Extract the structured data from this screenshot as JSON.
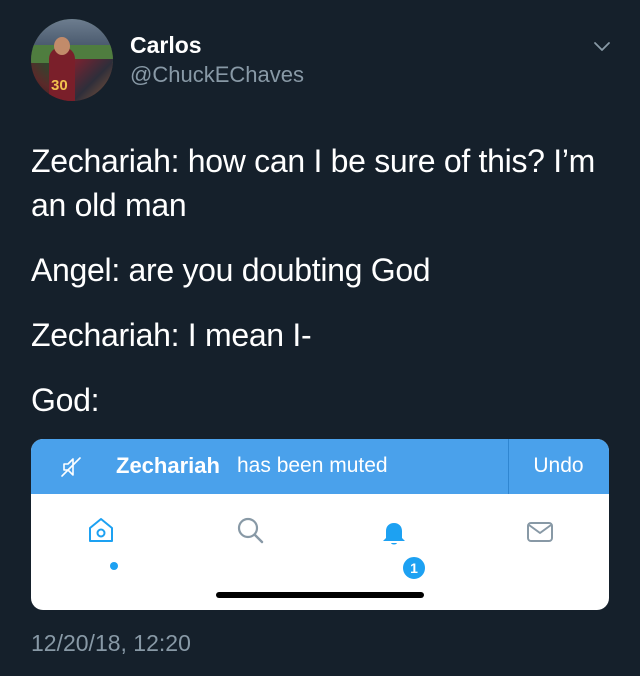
{
  "tweet": {
    "author": {
      "name": "Carlos",
      "handle": "@ChuckEChaves",
      "avatar_jersey_number": "30"
    },
    "lines": [
      "Zechariah: how can I be sure of this? I’m an old man",
      "Angel: are you doubting God",
      "Zechariah: I mean I-",
      "God:"
    ],
    "timestamp": "12/20/18, 12:20"
  },
  "embedded_screenshot": {
    "banner": {
      "icon": "mute-icon",
      "muted_name": "Zechariah",
      "message": "has been muted",
      "action_label": "Undo",
      "color": "#4aa1eb"
    },
    "tabbar": {
      "tabs": [
        {
          "name": "home",
          "icon": "home-icon",
          "has_dot": true
        },
        {
          "name": "search",
          "icon": "search-icon"
        },
        {
          "name": "notifications",
          "icon": "bell-icon",
          "badge": "1"
        },
        {
          "name": "messages",
          "icon": "mail-icon"
        }
      ]
    }
  },
  "colors": {
    "background": "#15202b",
    "secondary_text": "#8899a6",
    "accent": "#1da1f2"
  }
}
